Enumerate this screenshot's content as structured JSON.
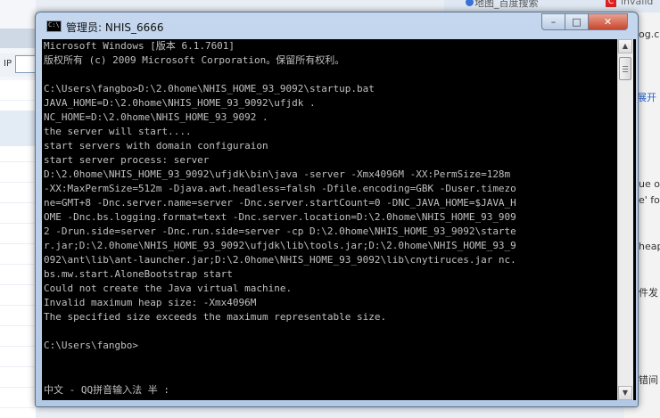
{
  "window": {
    "title": "管理员: NHIS_6666",
    "icon": "console-icon",
    "icon_text": "C:\\",
    "buttons": {
      "minimize": "–",
      "maximize": "□",
      "close": "✕"
    }
  },
  "console": {
    "lines": [
      "Microsoft Windows [版本 6.1.7601]",
      "版权所有 (c) 2009 Microsoft Corporation。保留所有权利。",
      "",
      "C:\\Users\\fangbo>D:\\2.0home\\NHIS_HOME_93_9092\\startup.bat",
      "JAVA_HOME=D:\\2.0home\\NHIS_HOME_93_9092\\ufjdk .",
      "NC_HOME=D:\\2.0home\\NHIS_HOME_93_9092 .",
      "the server will start....",
      "start servers with domain configuraion",
      "start server process: server",
      "D:\\2.0home\\NHIS_HOME_93_9092\\ufjdk\\bin\\java -server -Xmx4096M -XX:PermSize=128m",
      "-XX:MaxPermSize=512m -Djava.awt.headless=falsh -Dfile.encoding=GBK -Duser.timezo",
      "ne=GMT+8 -Dnc.server.name=server -Dnc.server.startCount=0 -DNC_JAVA_HOME=$JAVA_H",
      "OME -Dnc.bs.logging.format=text -Dnc.server.location=D:\\2.0home\\NHIS_HOME_93_909",
      "2 -Drun.side=server -Dnc.run.side=server -cp D:\\2.0home\\NHIS_HOME_93_9092\\starte",
      "r.jar;D:\\2.0home\\NHIS_HOME_93_9092\\ufjdk\\lib\\tools.jar;D:\\2.0home\\NHIS_HOME_93_9",
      "092\\ant\\lib\\ant-launcher.jar;D:\\2.0home\\NHIS_HOME_93_9092\\lib\\cnytiruces.jar nc.",
      "bs.mw.start.AloneBootstrap start",
      "Could not create the Java virtual machine.",
      "Invalid maximum heap size: -Xmx4096M",
      "The specified size exceeds the maximum representable size.",
      "",
      "C:\\Users\\fangbo>"
    ],
    "ime_status": "中文 - QQ拼音输入法 半 :"
  },
  "background": {
    "left_panel": {
      "ip_label": "IP"
    },
    "browser_tabs": [
      "地图_百度搜索",
      "invalid"
    ],
    "right_fragments": [
      "og.c",
      "展开",
      "ue o",
      "e' fo",
      "heap",
      "件发",
      "错间"
    ]
  }
}
